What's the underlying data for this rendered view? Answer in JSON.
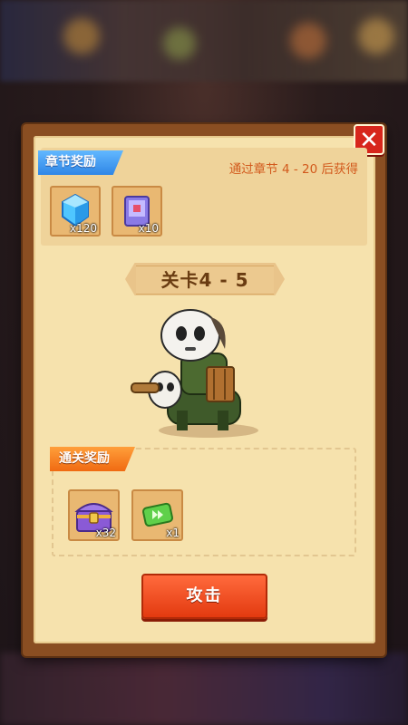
{
  "popup": {
    "close_label": "✕",
    "chapter_rewards": {
      "tag": "章节奖励",
      "note": "通过章节 4 - 20 后获得",
      "items": [
        {
          "icon": "blue-gem-icon",
          "count": "x120"
        },
        {
          "icon": "spell-book-icon",
          "count": "x10"
        }
      ]
    },
    "stage_title": "关卡4 - 5",
    "character": "skull-mask-rider-on-goat",
    "clear_rewards": {
      "tag": "通关奖励",
      "items": [
        {
          "icon": "treasure-chest-icon",
          "count": "x32"
        },
        {
          "icon": "fast-forward-ticket-icon",
          "count": "x1"
        }
      ]
    },
    "attack_label": "攻击"
  },
  "colors": {
    "frame": "#8a4e22",
    "paper": "#f6e2ad",
    "chapter_tag": "#2f86e6",
    "reward_tag": "#f06a12",
    "button": "#e33a10",
    "note_text": "#d2591c"
  }
}
